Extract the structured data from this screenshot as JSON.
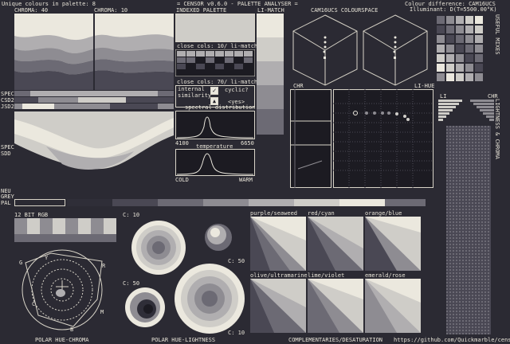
{
  "header": {
    "unique_colours": "Unique colours in palette: 8",
    "title": "= CENSOR v0.6.0 - PALETTE ANALYSER =",
    "colour_difference": "Colour difference: CAM16UCS",
    "illuminant": "Illuminant: D(T=5500.00°K)"
  },
  "labels": {
    "chroma40": "CHROMA: 40",
    "chroma10": "CHROMA: 10",
    "indexed_palette": "INDEXED PALETTE",
    "li_match": "LI-MATCH",
    "cam16ucs": "CAM16UCS COLOURSPACE",
    "close_cols_10": "close cols: 10/ li-match",
    "close_cols_70": "close cols: 70/ li-match",
    "internal_similarity_1": "internal",
    "internal_similarity_2": "similarity",
    "cyclic": "cyclic?",
    "yes": "<yes>",
    "spectral_distribution": "spectral distribution",
    "wl_min": "4100",
    "wl_max": "6650",
    "temperature": "temperature",
    "cold": "COLD",
    "warm": "WARM",
    "chr": "CHR",
    "li_hue": "LI-HUE",
    "li": "LI",
    "chr2": "CHR",
    "spec": "SPEC",
    "csd2": "CSD2",
    "jsd2": "JSD2",
    "spec2": "SPEC",
    "sdd": "SDD",
    "neu": "NEU",
    "grey": "GREY",
    "pal": "PAL",
    "rgb12": "12 BIT RGB",
    "c10_top": "C: 10",
    "c50_right": "C: 50",
    "c50_left": "C: 50",
    "c10_bottom": "C: 10",
    "polar_hue_chroma": "POLAR HUE-CHROMA",
    "polar_hue_lightness": "POLAR HUE-LIGHTNESS",
    "complementaries": "COMPLEMENTARIES/DESATURATION",
    "url": "https://github.com/Quickmarble/censor",
    "side_useful_mixes": "USEFUL MIXES",
    "side_lightness_chroma": "LIGHTNESS & CHROMA",
    "pair_purple": "purple/seaweed",
    "pair_red": "red/cyan",
    "pair_orange": "orange/blue",
    "pair_olive": "olive/ultramarine",
    "pair_lime": "lime/violet",
    "pair_emerald": "emerald/rose",
    "wheel_g": "G",
    "wheel_y": "Y",
    "wheel_r": "R",
    "wheel_c": "C",
    "wheel_m": "M",
    "wheel_b": "B"
  },
  "palette": [
    "#1c1b22",
    "#2f2e38",
    "#4a4854",
    "#6c6a74",
    "#8e8c92",
    "#b0aeb0",
    "#cfcdc8",
    "#ebe8de"
  ],
  "colors": {
    "bg": "#2b2a33",
    "ink": "#e8e4d8",
    "line": "#d8d4c8",
    "dark": "#1c1b22"
  }
}
